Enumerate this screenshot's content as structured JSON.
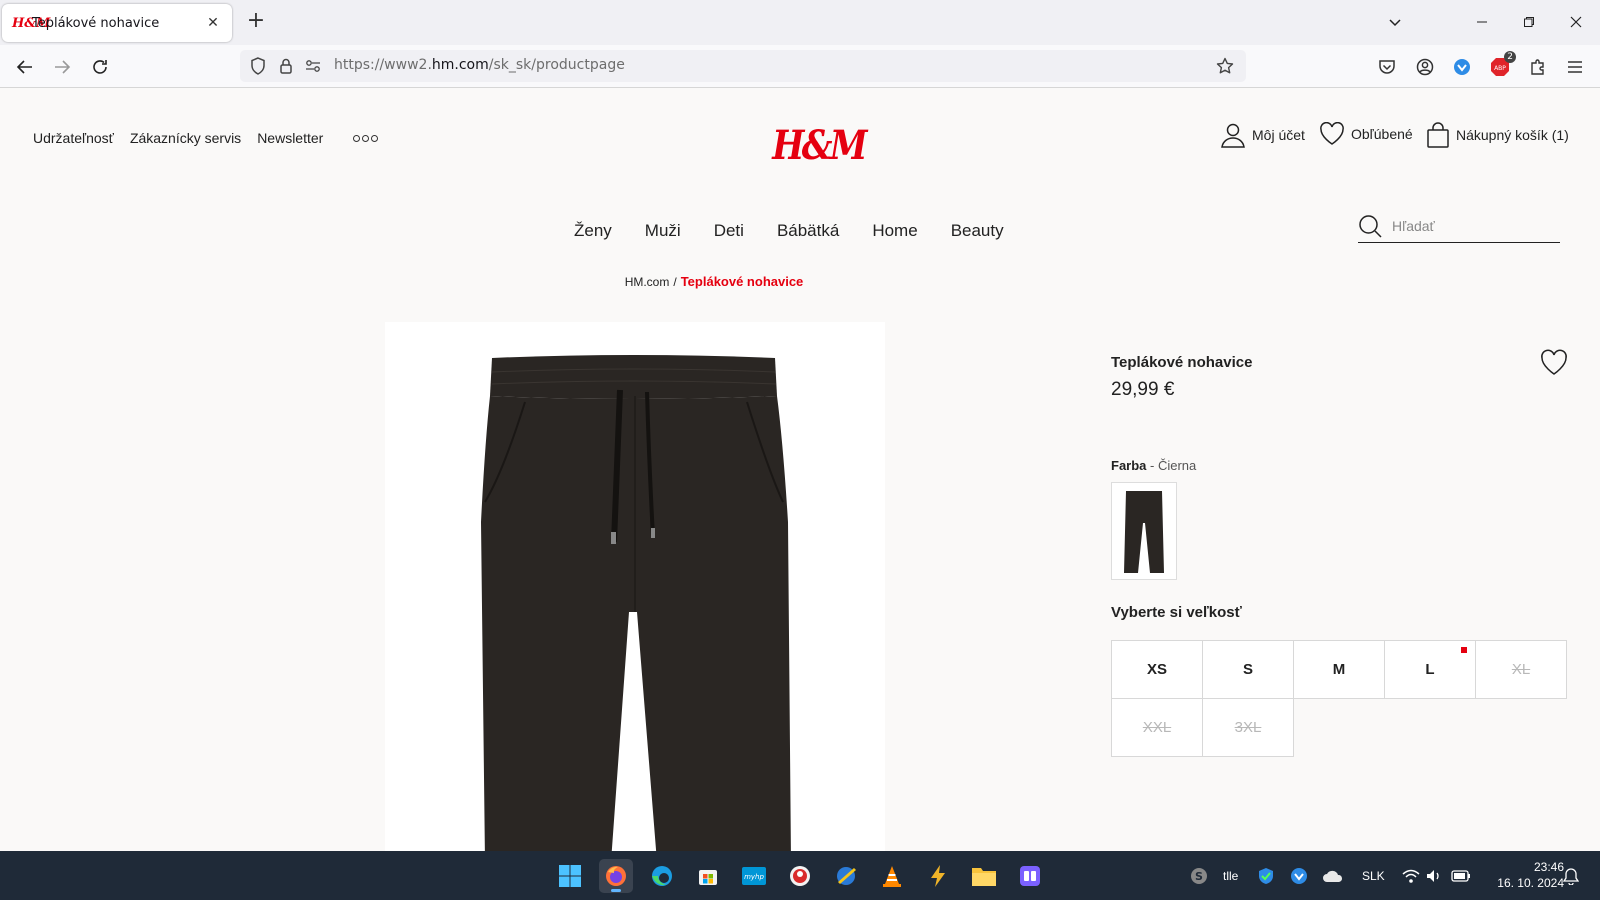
{
  "browser": {
    "tab_title": "Teplákové nohavice",
    "tab_favicon": "H&M",
    "url_prefix": "https://www2.",
    "url_domain": "hm.com",
    "url_path": "/sk_sk/productpage",
    "ext_badge_count": "2"
  },
  "header": {
    "top_links": [
      "Udržateľnosť",
      "Zákaznícky servis",
      "Newsletter"
    ],
    "logo": "H&M",
    "account_label": "Môj účet",
    "favorites_label": "Obľúbené",
    "cart_label": "Nákupný košík (1)"
  },
  "nav": {
    "items": [
      "Ženy",
      "Muži",
      "Deti",
      "Bábätká",
      "Home",
      "Beauty"
    ]
  },
  "search": {
    "placeholder": "Hľadať"
  },
  "breadcrumb": {
    "home": "HM.com",
    "separator": "/",
    "current": "Teplákové nohavice"
  },
  "product": {
    "title": "Teplákové nohavice",
    "price": "29,99 €",
    "color_label": "Farba",
    "color_value": "- Čierna",
    "size_heading": "Vyberte si veľkosť",
    "sizes": [
      {
        "label": "XS",
        "available": true
      },
      {
        "label": "S",
        "available": true
      },
      {
        "label": "M",
        "available": true
      },
      {
        "label": "L",
        "available": true,
        "low_stock": true
      },
      {
        "label": "XL",
        "available": false
      },
      {
        "label": "XXL",
        "available": false
      },
      {
        "label": "3XL",
        "available": false
      }
    ]
  },
  "taskbar": {
    "tray_text": "tlle",
    "language": "SLK",
    "time": "23:46",
    "date": "16. 10. 2024"
  },
  "colors": {
    "brand_red": "#e50010",
    "taskbar_bg": "#1f2a38",
    "pants": "#2a2623"
  }
}
